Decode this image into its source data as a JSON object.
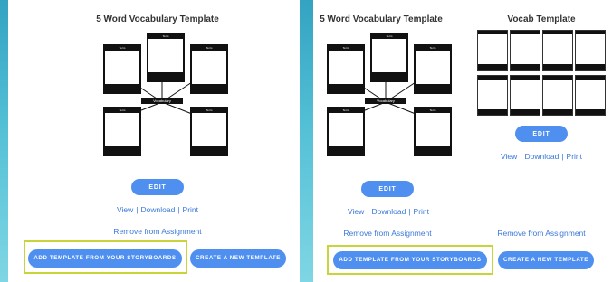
{
  "left_card": {
    "title": "5 Word Vocabulary Template",
    "diagram": {
      "center_label": "Vocabulary",
      "frame_caption": "Term"
    },
    "edit_label": "EDIT",
    "view_label": "View",
    "download_label": "Download",
    "print_label": "Print",
    "separator": "|",
    "remove_label": "Remove from Assignment",
    "add_template_label": "ADD TEMPLATE FROM YOUR STORYBOARDS",
    "create_template_label": "CREATE A NEW TEMPLATE"
  },
  "right_card": {
    "first_template": {
      "title": "5 Word Vocabulary Template",
      "edit_label": "EDIT",
      "view_label": "View",
      "download_label": "Download",
      "print_label": "Print",
      "separator": "|"
    },
    "second_template": {
      "title": "Vocab Template",
      "edit_label": "EDIT",
      "view_label": "View",
      "download_label": "Download",
      "print_label": "Print",
      "separator": "|"
    },
    "remove_label": "Remove from Assignment",
    "add_template_label": "ADD TEMPLATE FROM YOUR STORYBOARDS",
    "create_template_label": "CREATE A NEW TEMPLATE"
  },
  "colors": {
    "button_blue": "#4f8ff0",
    "link_blue": "#3a78d8",
    "highlight": "#c9d33a",
    "background_teal": "#33a3c2"
  }
}
